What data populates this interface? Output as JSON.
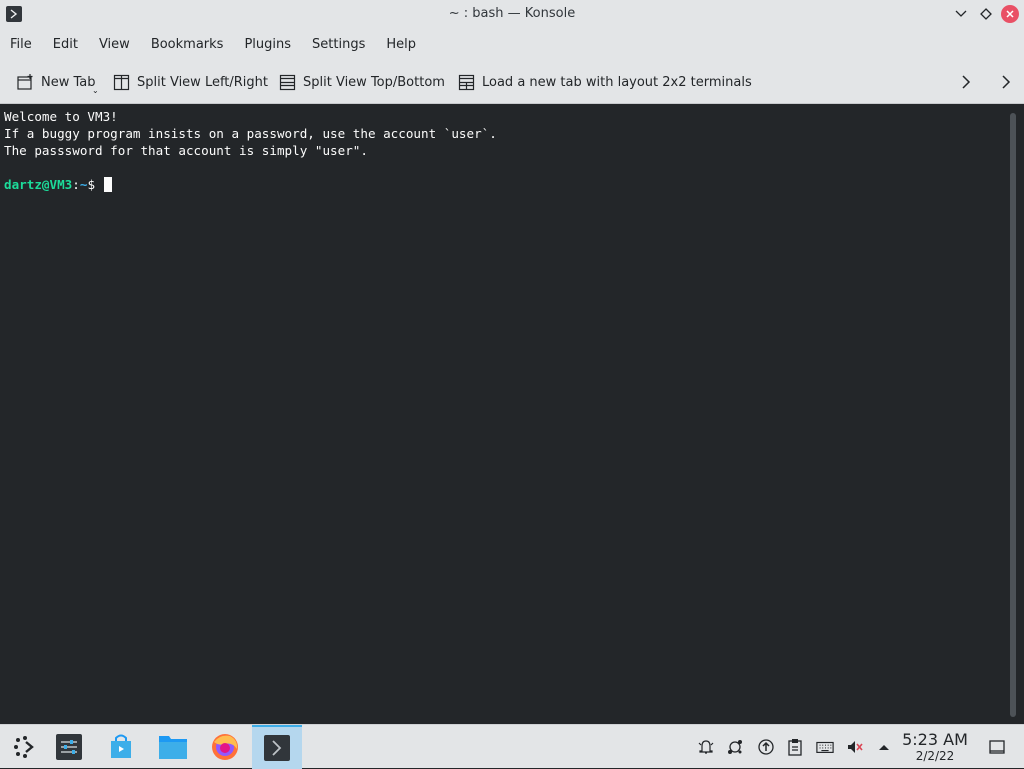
{
  "window": {
    "title": "~ : bash — Konsole"
  },
  "menu": {
    "items": [
      "File",
      "Edit",
      "View",
      "Bookmarks",
      "Plugins",
      "Settings",
      "Help"
    ]
  },
  "toolbar": {
    "new_tab": "New Tab",
    "split_lr": "Split View Left/Right",
    "split_tb": "Split View Top/Bottom",
    "load_layout": "Load a new tab with layout 2x2 terminals"
  },
  "terminal": {
    "lines": [
      "Welcome to VM3!",
      "If a buggy program insists on a password, use the account `user`.",
      "The passsword for that account is simply \"user\"."
    ],
    "prompt_user": "dartz@VM3",
    "prompt_sep": ":",
    "prompt_dir": "~",
    "prompt_symbol": "$"
  },
  "taskbar": {
    "apps": [
      "application-launcher-icon",
      "system-settings-icon",
      "discover-store-icon",
      "dolphin-file-manager-icon",
      "firefox-icon",
      "konsole-icon"
    ],
    "time": "5:23 AM",
    "date": "2/2/22"
  },
  "colors": {
    "terminal_bg": "#232629",
    "prompt_user": "#1cdc9a",
    "prompt_dir": "#3daee9",
    "close_button": "#e95065"
  }
}
